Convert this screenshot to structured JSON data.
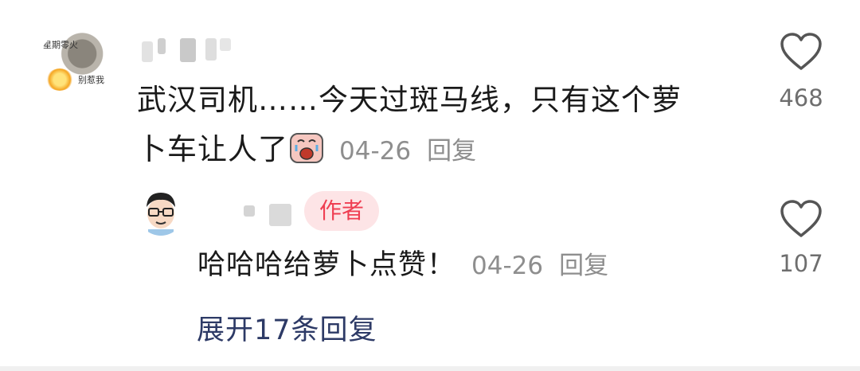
{
  "comment": {
    "avatar_caption_1": "星期零火",
    "avatar_caption_2": "别惹我",
    "text_line1": "武汉司机……今天过斑马线，只有这个萝",
    "text_line2": "卜车让人了",
    "emoji": "crying-face",
    "date": "04-26",
    "reply_label": "回复",
    "like_count": "468"
  },
  "reply": {
    "author_badge": "作者",
    "text": "哈哈哈给萝卜点赞！",
    "date": "04-26",
    "reply_label": "回复",
    "like_count": "107"
  },
  "expand_label": "展开17条回复",
  "colors": {
    "author_badge_bg": "#fde4e6",
    "author_badge_text": "#ef3e52",
    "expand_link": "#2d3a66",
    "meta_gray": "#8e8e8e"
  }
}
